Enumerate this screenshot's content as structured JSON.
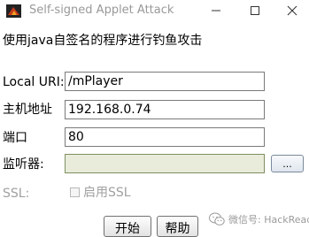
{
  "window": {
    "title": "Self-signed Applet Attack",
    "controls": {
      "minimize_icon": "minimize-icon",
      "maximize_icon": "maximize-icon",
      "close_icon": "close-icon"
    }
  },
  "subtitle": "使用java自签名的程序进行钓鱼攻击",
  "form": {
    "local_uri": {
      "label": "Local URI:",
      "value": "/mPlayer"
    },
    "host": {
      "label": "主机地址",
      "value": "192.168.0.74"
    },
    "port": {
      "label": "端口",
      "value": "80"
    },
    "listener": {
      "label": "监听器:",
      "value": "",
      "browse_label": "..."
    },
    "ssl": {
      "label": "SSL:",
      "checkbox_label": "启用SSL",
      "checked": false
    }
  },
  "buttons": {
    "start": "开始",
    "help": "帮助"
  },
  "watermark": {
    "text": "微信号: HackRead",
    "icon": "wechat-icon"
  },
  "colors": {
    "listener_field_bg": "#e9ecdb",
    "disabled_text": "#a0a0a0"
  }
}
